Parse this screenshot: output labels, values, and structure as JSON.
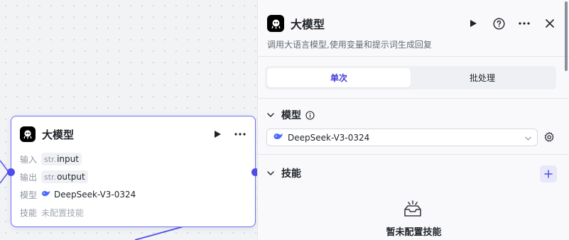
{
  "node": {
    "title": "大模型",
    "rows": {
      "input_label": "输入",
      "input_type": "str.",
      "input_value": "input",
      "output_label": "输出",
      "output_type": "str.",
      "output_value": "output",
      "model_label": "模型",
      "model_value": "DeepSeek-V3-0324",
      "skill_label": "技能",
      "skill_value": "未配置技能"
    }
  },
  "panel": {
    "title": "大模型",
    "description": "调用大语言模型,使用变量和提示词生成回复",
    "tabs": [
      {
        "label": "单次",
        "active": true
      },
      {
        "label": "批处理",
        "active": false
      }
    ],
    "model_section": {
      "title": "模型",
      "selected_model": "DeepSeek-V3-0324"
    },
    "skill_section": {
      "title": "技能",
      "empty_text": "暂未配置技能"
    }
  },
  "icons": {
    "node_logo": "llm-logo-icon",
    "run": "play-icon",
    "help": "help-circle-icon",
    "more": "more-dots-icon",
    "close": "close-icon",
    "model_brand": "deepseek-whale-icon",
    "info": "info-icon",
    "settings": "gear-icon",
    "add": "plus-icon",
    "empty": "empty-box-icon"
  },
  "colors": {
    "accent": "#4e4ee8",
    "node_border": "#6e6ef0",
    "tab_active_text": "#3e3ad9",
    "deepseek_blue": "#4d6bfe"
  }
}
